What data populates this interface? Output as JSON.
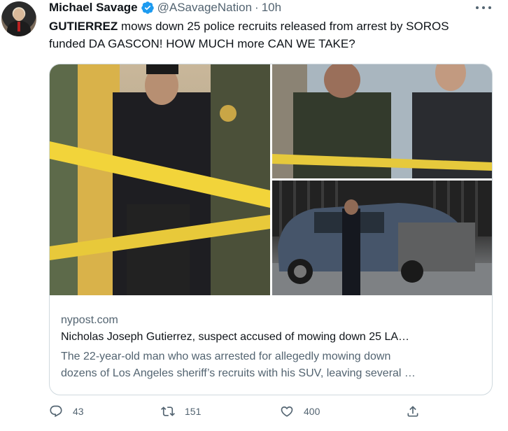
{
  "author": {
    "name": "Michael Savage",
    "handle": "@ASavageNation",
    "separator": "·",
    "time": "10h"
  },
  "tweet": {
    "line1": "GUTIERREZ mows down 25 police recruits released from arrest by SOROS",
    "line2": "funded DA GASCON!  HOW MUCH  more CAN WE TAKE?"
  },
  "card": {
    "domain": "nypost.com",
    "title": "Nicholas Joseph Gutierrez, suspect accused of mowing down 25 LA…",
    "desc_line1": "The 22-year-old man who was arrested for allegedly mowing down",
    "desc_line2": "dozens of Los Angeles sheriff’s recruits with his SUV, leaving several …"
  },
  "actions": {
    "replies": "43",
    "retweets": "151",
    "likes": "400"
  },
  "colors": {
    "verified": "#1d9bf0",
    "secondary_text": "#536471",
    "border": "#cfd9de"
  },
  "icons": [
    "verified-badge-icon",
    "more-options-icon",
    "reply-icon",
    "retweet-icon",
    "like-icon",
    "share-icon"
  ]
}
